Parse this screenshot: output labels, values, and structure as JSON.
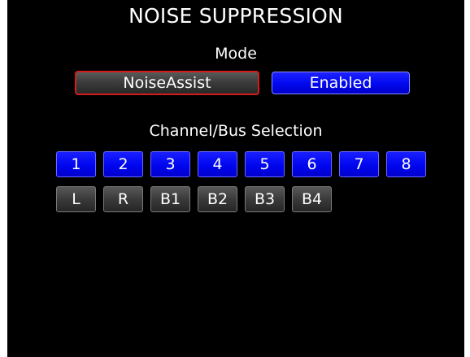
{
  "screen": {
    "title": "NOISE SUPPRESSION"
  },
  "mode": {
    "label": "Mode",
    "type_button": "NoiseAssist",
    "state_button": "Enabled"
  },
  "channel_selection": {
    "label": "Channel/Bus Selection",
    "channels": [
      "1",
      "2",
      "3",
      "4",
      "5",
      "6",
      "7",
      "8"
    ],
    "channel_state": [
      "selected",
      "selected",
      "selected",
      "selected",
      "selected",
      "selected",
      "selected",
      "selected"
    ],
    "buses": [
      "L",
      "R",
      "B1",
      "B2",
      "B3",
      "B4"
    ],
    "bus_state": [
      "unselected",
      "unselected",
      "unselected",
      "unselected",
      "unselected",
      "unselected"
    ]
  },
  "colors": {
    "background": "#000000",
    "selected": "#0008ee",
    "unselected": "#3a3a3a",
    "focus_border": "#d21c1c",
    "text": "#ffffff"
  }
}
